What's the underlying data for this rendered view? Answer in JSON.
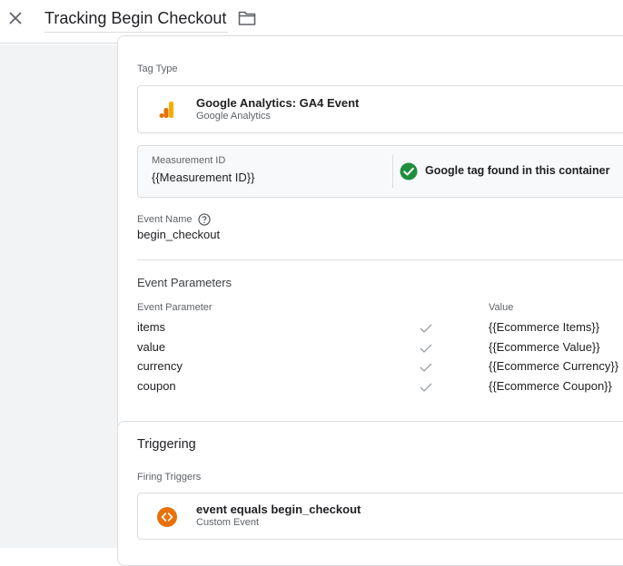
{
  "header": {
    "title": "Tracking Begin Checkout",
    "close_icon": "close-icon",
    "folder_icon": "folder-icon"
  },
  "tag_config": {
    "tag_type_label": "Tag Type",
    "tag_type_name": "Google Analytics: GA4 Event",
    "tag_type_sub": "Google Analytics",
    "tag_type_icon": "google-analytics-icon",
    "measurement_id_label": "Measurement ID",
    "measurement_id_value": "{{Measurement ID}}",
    "google_tag_status": "Google tag found in this container",
    "event_name_label": "Event Name",
    "event_name_value": "begin_checkout",
    "event_params_title": "Event Parameters",
    "col_param": "Event Parameter",
    "col_value": "Value",
    "params": [
      {
        "name": "items",
        "value": "{{Ecommerce Items}}"
      },
      {
        "name": "value",
        "value": "{{Ecommerce Value}}"
      },
      {
        "name": "currency",
        "value": "{{Ecommerce Currency}}"
      },
      {
        "name": "coupon",
        "value": "{{Ecommerce Coupon}}"
      }
    ]
  },
  "triggering": {
    "title": "Triggering",
    "firing_label": "Firing Triggers",
    "trigger_name": "event equals begin_checkout",
    "trigger_sub": "Custom Event",
    "trigger_icon": "custom-event-icon"
  },
  "colors": {
    "accent_green": "#1e8e3e",
    "trigger_orange": "#e8710a",
    "ga_orange": "#f9ab00"
  }
}
